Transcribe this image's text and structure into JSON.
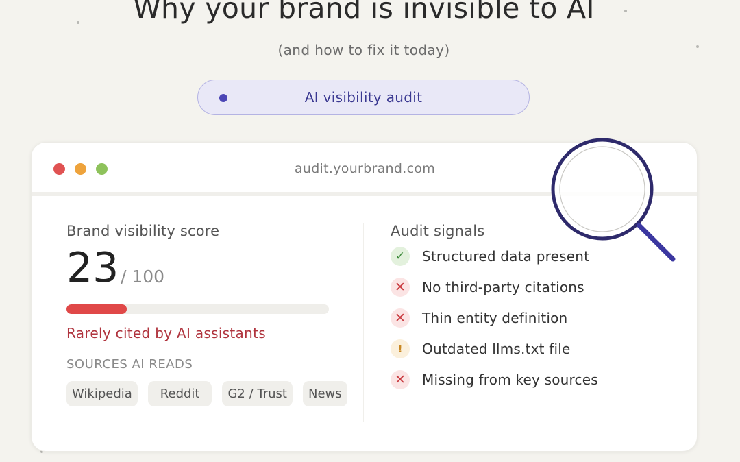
{
  "header": {
    "title": "Why your brand is invisible to AI",
    "subtitle": "(and how to fix it today)",
    "badge_label": "AI visibility audit"
  },
  "window": {
    "url": "audit.yourbrand.com"
  },
  "score": {
    "label": "Brand visibility score",
    "value": "23",
    "max": "/ 100",
    "progress_fraction": 0.23,
    "status": "Rarely cited by AI assistants"
  },
  "sources": {
    "label": "SOURCES AI READS",
    "tags": [
      "Wikipedia",
      "Reddit",
      "G2 / Trust",
      "News"
    ]
  },
  "signals": {
    "label": "Audit signals",
    "items": [
      {
        "text": "Structured data present",
        "status": "ok",
        "icon": "check-icon"
      },
      {
        "text": "No third-party citations",
        "status": "bad",
        "icon": "x-icon"
      },
      {
        "text": "Thin entity definition",
        "status": "bad",
        "icon": "x-icon"
      },
      {
        "text": "Outdated llms.txt file",
        "status": "warn",
        "icon": "exclamation-icon"
      },
      {
        "text": "Missing from key sources",
        "status": "bad",
        "icon": "x-icon"
      }
    ]
  },
  "colors": {
    "background": "#f4f3ee",
    "accent": "#4b45b5",
    "danger": "#e04848",
    "magnifier": "#2e2a6b"
  }
}
